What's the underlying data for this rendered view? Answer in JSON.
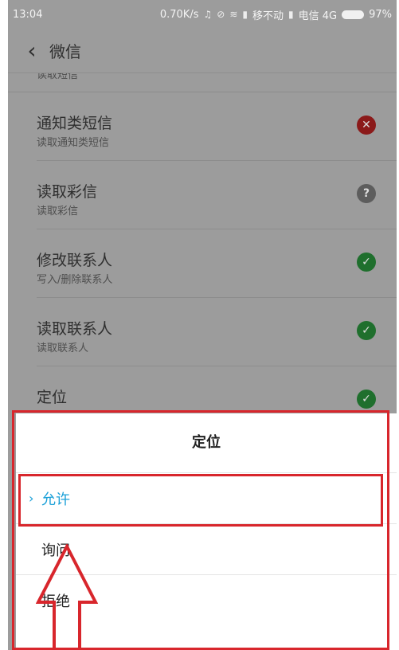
{
  "status_bar": {
    "time": "13:04",
    "network_speed": "0.70K/s",
    "carrier_1": "移不动",
    "carrier_2": "电信 4G",
    "battery": "97%",
    "icons": [
      "headphones-icon",
      "mute-icon",
      "wifi-icon",
      "signal-icon",
      "signal-icon"
    ]
  },
  "titlebar": {
    "back_icon": "‹",
    "title": "微信"
  },
  "permissions": {
    "partial_label": "读取短信",
    "items": [
      {
        "title": "通知类短信",
        "description": "读取通知类短信",
        "status": "deny",
        "status_glyph": "✕"
      },
      {
        "title": "读取彩信",
        "description": "读取彩信",
        "status": "ask",
        "status_glyph": "?"
      },
      {
        "title": "修改联系人",
        "description": "写入/删除联系人",
        "status": "allow",
        "status_glyph": "✓"
      },
      {
        "title": "读取联系人",
        "description": "读取联系人",
        "status": "allow",
        "status_glyph": "✓"
      },
      {
        "title": "定位",
        "description": "",
        "status": "allow",
        "status_glyph": "✓"
      }
    ]
  },
  "dialog": {
    "title": "定位",
    "options": [
      {
        "label": "允许",
        "selected": true
      },
      {
        "label": "询问",
        "selected": false
      },
      {
        "label": "拒绝",
        "selected": false
      }
    ],
    "check_icon": "›"
  },
  "colors": {
    "annotation": "#d8262c",
    "accent": "#1aa0d8",
    "deny": "#8b1a1a",
    "ask": "#5d5d5d",
    "allow": "#1f6f2d"
  }
}
